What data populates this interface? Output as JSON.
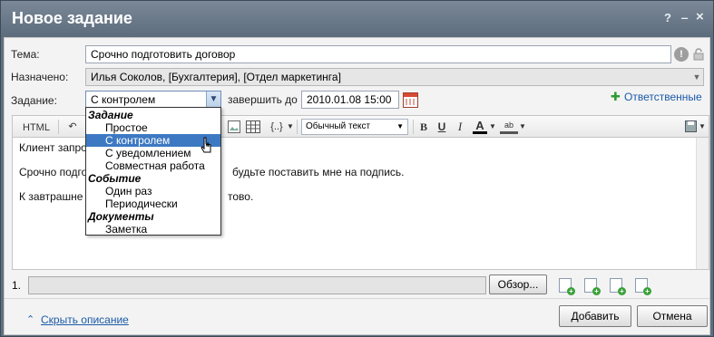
{
  "window": {
    "title": "Новое задание",
    "help": "?",
    "min": "‒",
    "close": "×"
  },
  "form": {
    "subject_label": "Тема:",
    "subject_value": "Срочно подготовить договор",
    "assigned_label": "Назначено:",
    "assigned_value": "Илья Соколов, [Бухгалтерия], [Отдел маркетинга]",
    "task_label": "Задание:",
    "task_type_value": "С контролем",
    "deadline_label": "завершить до",
    "deadline_value": "2010.01.08 15:00",
    "responsible_link": "Ответственные"
  },
  "toolbar": {
    "html": "HTML",
    "undo": "↶",
    "style": "Обычный текст",
    "bold": "B",
    "underline": "U",
    "italic": "I",
    "textcolor": "A",
    "highlight": "ab",
    "braces": "{..}"
  },
  "editor": {
    "line1": "Клиент запро",
    "line2a": "Срочно подго",
    "line2b": "будьте поставить мне на подпись.",
    "line3a": "К завтрашне",
    "line3b": "тово."
  },
  "dropdown": {
    "groups": [
      {
        "label": "Задание",
        "items": [
          "Простое",
          "С контролем",
          "С уведомлением",
          "Совместная работа"
        ]
      },
      {
        "label": "Событие",
        "items": [
          "Один раз",
          "Периодически"
        ]
      },
      {
        "label": "Документы",
        "items": [
          "Заметка"
        ]
      }
    ],
    "selected": "С контролем"
  },
  "attachment": {
    "row_number": "1.",
    "browse_button": "Обзор..."
  },
  "footer": {
    "hide_description": "Скрыть описание",
    "add_button": "Добавить",
    "cancel_button": "Отмена"
  },
  "colors": {
    "titlebar": "#5d6c7c",
    "selection": "#3d79c3",
    "link": "#1a5aa8"
  }
}
